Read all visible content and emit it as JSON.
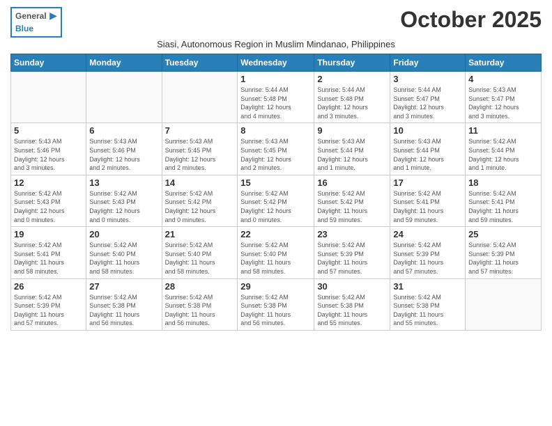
{
  "header": {
    "logo_general": "General",
    "logo_blue": "Blue",
    "month_title": "October 2025",
    "subtitle": "Siasi, Autonomous Region in Muslim Mindanao, Philippines"
  },
  "weekdays": [
    "Sunday",
    "Monday",
    "Tuesday",
    "Wednesday",
    "Thursday",
    "Friday",
    "Saturday"
  ],
  "weeks": [
    [
      {
        "day": "",
        "info": ""
      },
      {
        "day": "",
        "info": ""
      },
      {
        "day": "",
        "info": ""
      },
      {
        "day": "1",
        "info": "Sunrise: 5:44 AM\nSunset: 5:48 PM\nDaylight: 12 hours\nand 4 minutes."
      },
      {
        "day": "2",
        "info": "Sunrise: 5:44 AM\nSunset: 5:48 PM\nDaylight: 12 hours\nand 3 minutes."
      },
      {
        "day": "3",
        "info": "Sunrise: 5:44 AM\nSunset: 5:47 PM\nDaylight: 12 hours\nand 3 minutes."
      },
      {
        "day": "4",
        "info": "Sunrise: 5:43 AM\nSunset: 5:47 PM\nDaylight: 12 hours\nand 3 minutes."
      }
    ],
    [
      {
        "day": "5",
        "info": "Sunrise: 5:43 AM\nSunset: 5:46 PM\nDaylight: 12 hours\nand 3 minutes."
      },
      {
        "day": "6",
        "info": "Sunrise: 5:43 AM\nSunset: 5:46 PM\nDaylight: 12 hours\nand 2 minutes."
      },
      {
        "day": "7",
        "info": "Sunrise: 5:43 AM\nSunset: 5:45 PM\nDaylight: 12 hours\nand 2 minutes."
      },
      {
        "day": "8",
        "info": "Sunrise: 5:43 AM\nSunset: 5:45 PM\nDaylight: 12 hours\nand 2 minutes."
      },
      {
        "day": "9",
        "info": "Sunrise: 5:43 AM\nSunset: 5:44 PM\nDaylight: 12 hours\nand 1 minute."
      },
      {
        "day": "10",
        "info": "Sunrise: 5:43 AM\nSunset: 5:44 PM\nDaylight: 12 hours\nand 1 minute."
      },
      {
        "day": "11",
        "info": "Sunrise: 5:42 AM\nSunset: 5:44 PM\nDaylight: 12 hours\nand 1 minute."
      }
    ],
    [
      {
        "day": "12",
        "info": "Sunrise: 5:42 AM\nSunset: 5:43 PM\nDaylight: 12 hours\nand 0 minutes."
      },
      {
        "day": "13",
        "info": "Sunrise: 5:42 AM\nSunset: 5:43 PM\nDaylight: 12 hours\nand 0 minutes."
      },
      {
        "day": "14",
        "info": "Sunrise: 5:42 AM\nSunset: 5:42 PM\nDaylight: 12 hours\nand 0 minutes."
      },
      {
        "day": "15",
        "info": "Sunrise: 5:42 AM\nSunset: 5:42 PM\nDaylight: 12 hours\nand 0 minutes."
      },
      {
        "day": "16",
        "info": "Sunrise: 5:42 AM\nSunset: 5:42 PM\nDaylight: 11 hours\nand 59 minutes."
      },
      {
        "day": "17",
        "info": "Sunrise: 5:42 AM\nSunset: 5:41 PM\nDaylight: 11 hours\nand 59 minutes."
      },
      {
        "day": "18",
        "info": "Sunrise: 5:42 AM\nSunset: 5:41 PM\nDaylight: 11 hours\nand 59 minutes."
      }
    ],
    [
      {
        "day": "19",
        "info": "Sunrise: 5:42 AM\nSunset: 5:41 PM\nDaylight: 11 hours\nand 58 minutes."
      },
      {
        "day": "20",
        "info": "Sunrise: 5:42 AM\nSunset: 5:40 PM\nDaylight: 11 hours\nand 58 minutes."
      },
      {
        "day": "21",
        "info": "Sunrise: 5:42 AM\nSunset: 5:40 PM\nDaylight: 11 hours\nand 58 minutes."
      },
      {
        "day": "22",
        "info": "Sunrise: 5:42 AM\nSunset: 5:40 PM\nDaylight: 11 hours\nand 58 minutes."
      },
      {
        "day": "23",
        "info": "Sunrise: 5:42 AM\nSunset: 5:39 PM\nDaylight: 11 hours\nand 57 minutes."
      },
      {
        "day": "24",
        "info": "Sunrise: 5:42 AM\nSunset: 5:39 PM\nDaylight: 11 hours\nand 57 minutes."
      },
      {
        "day": "25",
        "info": "Sunrise: 5:42 AM\nSunset: 5:39 PM\nDaylight: 11 hours\nand 57 minutes."
      }
    ],
    [
      {
        "day": "26",
        "info": "Sunrise: 5:42 AM\nSunset: 5:39 PM\nDaylight: 11 hours\nand 57 minutes."
      },
      {
        "day": "27",
        "info": "Sunrise: 5:42 AM\nSunset: 5:38 PM\nDaylight: 11 hours\nand 56 minutes."
      },
      {
        "day": "28",
        "info": "Sunrise: 5:42 AM\nSunset: 5:38 PM\nDaylight: 11 hours\nand 56 minutes."
      },
      {
        "day": "29",
        "info": "Sunrise: 5:42 AM\nSunset: 5:38 PM\nDaylight: 11 hours\nand 56 minutes."
      },
      {
        "day": "30",
        "info": "Sunrise: 5:42 AM\nSunset: 5:38 PM\nDaylight: 11 hours\nand 55 minutes."
      },
      {
        "day": "31",
        "info": "Sunrise: 5:42 AM\nSunset: 5:38 PM\nDaylight: 11 hours\nand 55 minutes."
      },
      {
        "day": "",
        "info": ""
      }
    ]
  ]
}
